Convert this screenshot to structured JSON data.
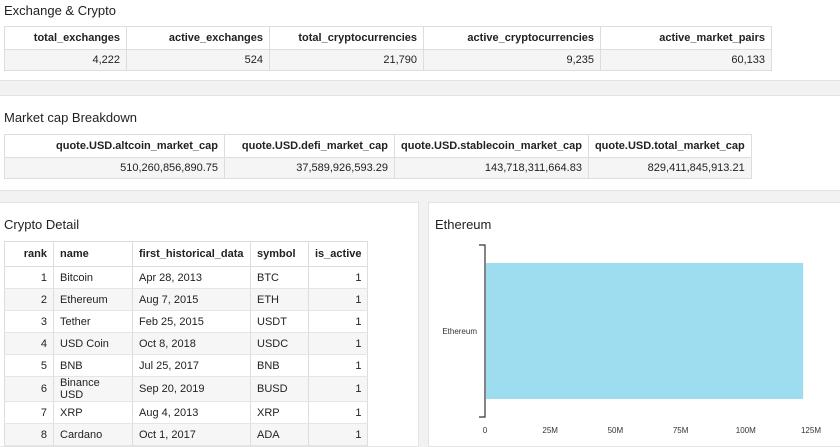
{
  "exchange_panel": {
    "title": "Exchange & Crypto",
    "columns": [
      "total_exchanges",
      "active_exchanges",
      "total_cryptocurrencies",
      "active_cryptocurrencies",
      "active_market_pairs"
    ],
    "values": [
      "4,222",
      "524",
      "21,790",
      "9,235",
      "60,133"
    ]
  },
  "market_cap_panel": {
    "title": "Market cap Breakdown",
    "columns": [
      "quote.USD.altcoin_market_cap",
      "quote.USD.defi_market_cap",
      "quote.USD.stablecoin_market_cap",
      "quote.USD.total_market_cap"
    ],
    "values": [
      "510,260,856,890.75",
      "37,589,926,593.29",
      "143,718,311,664.83",
      "829,411,845,913.21"
    ]
  },
  "crypto_detail_panel": {
    "title": "Crypto Detail",
    "columns": [
      "rank",
      "name",
      "first_historical_data",
      "symbol",
      "is_active"
    ],
    "rows": [
      [
        "1",
        "Bitcoin",
        "Apr 28, 2013",
        "BTC",
        "1"
      ],
      [
        "2",
        "Ethereum",
        "Aug 7, 2015",
        "ETH",
        "1"
      ],
      [
        "3",
        "Tether",
        "Feb 25, 2015",
        "USDT",
        "1"
      ],
      [
        "4",
        "USD Coin",
        "Oct 8, 2018",
        "USDC",
        "1"
      ],
      [
        "5",
        "BNB",
        "Jul 25, 2017",
        "BNB",
        "1"
      ],
      [
        "6",
        "Binance USD",
        "Sep 20, 2019",
        "BUSD",
        "1"
      ],
      [
        "7",
        "XRP",
        "Aug 4, 2013",
        "XRP",
        "1"
      ],
      [
        "8",
        "Cardano",
        "Oct 1, 2017",
        "ADA",
        "1"
      ]
    ]
  },
  "ethereum_panel": {
    "title": "Ethereum"
  },
  "colors": {
    "bar": "#9edcef",
    "axis": "#333333"
  },
  "chart_data": {
    "type": "bar",
    "orientation": "horizontal",
    "categories": [
      "Ethereum"
    ],
    "values": [
      122000000
    ],
    "xlim": [
      0,
      125000000
    ],
    "xticks": [
      0,
      25000000,
      50000000,
      75000000,
      100000000,
      125000000
    ],
    "xtick_labels": [
      "0",
      "25M",
      "50M",
      "75M",
      "100M",
      "125M"
    ],
    "grid": false
  }
}
